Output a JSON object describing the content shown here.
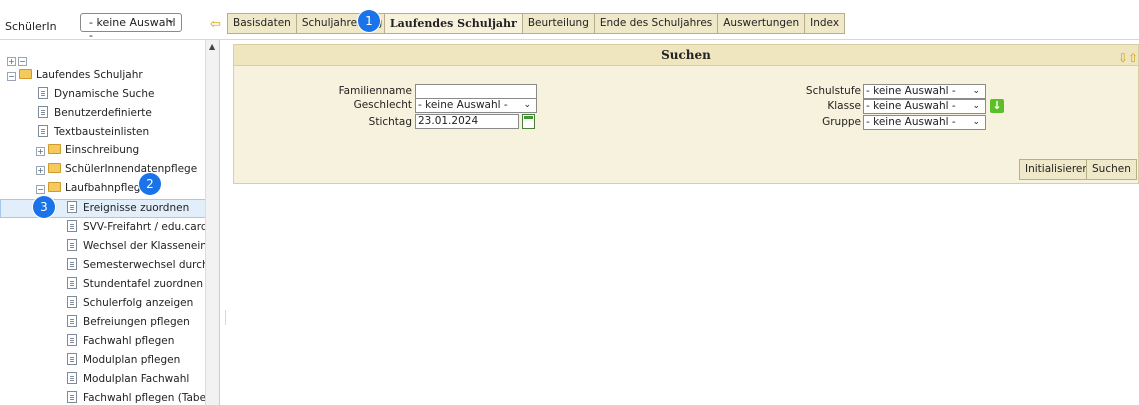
{
  "topbar": {
    "student_label": "SchülerIn",
    "student_select": "- keine Auswahl -",
    "tabs": [
      "Basisdaten",
      "Schuljahresbeginn",
      "Laufendes Schuljahr",
      "Beurteilung",
      "Ende des Schuljahres",
      "Auswertungen",
      "Index"
    ],
    "tab_visible_text": [
      "Basisdaten",
      "Schuljahresbeg",
      "Laufendes Schuljahr",
      "Beurteilung",
      "Ende des Schuljahres",
      "Auswertungen",
      "Index"
    ],
    "active_tab": "Laufendes Schuljahr"
  },
  "badges": [
    "1",
    "2",
    "3"
  ],
  "tree": {
    "root": "Laufendes Schuljahr",
    "items": [
      "Dynamische Suche",
      "Benutzerdefinierte",
      "Textbausteinlisten",
      "Einschreibung",
      "SchülerInnendatenpflege",
      "Laufbahnpflege",
      "Ereignisse zuordnen",
      "SVV-Freifahrt / edu.card dru",
      "Wechsel der Klasseneinteilun",
      "Semesterwechsel durchführe",
      "Stundentafel zuordnen",
      "Schulerfolg anzeigen",
      "Befreiungen pflegen",
      "Fachwahl pflegen",
      "Modulplan pflegen",
      "Modulplan Fachwahl",
      "Fachwahl pflegen (Tabelle)"
    ],
    "selected": "Ereignisse zuordnen"
  },
  "search": {
    "title": "Suchen",
    "familienname_label": "Familienname",
    "familienname_value": "",
    "geschlecht_label": "Geschlecht",
    "geschlecht_value": "- keine Auswahl -",
    "stichtag_label": "Stichtag",
    "stichtag_value": "23.01.2024",
    "schulstufe_label": "Schulstufe",
    "schulstufe_value": "- keine Auswahl -",
    "klasse_label": "Klasse",
    "klasse_value": "- keine Auswahl -",
    "gruppe_label": "Gruppe",
    "gruppe_value": "- keine Auswahl -",
    "btn_init": "Initialisieren",
    "btn_search": "Suchen"
  },
  "colors": {
    "tab_bg": "#efe8c9",
    "panel_bg": "#f6f2dd",
    "badge": "#1a73e8",
    "selection": "#e3eefb"
  },
  "icons": [
    "back-arrow-icon",
    "folder-icon",
    "document-icon",
    "calendar-icon",
    "green-down-arrow-icon",
    "minimize-icon",
    "maximize-icon"
  ]
}
